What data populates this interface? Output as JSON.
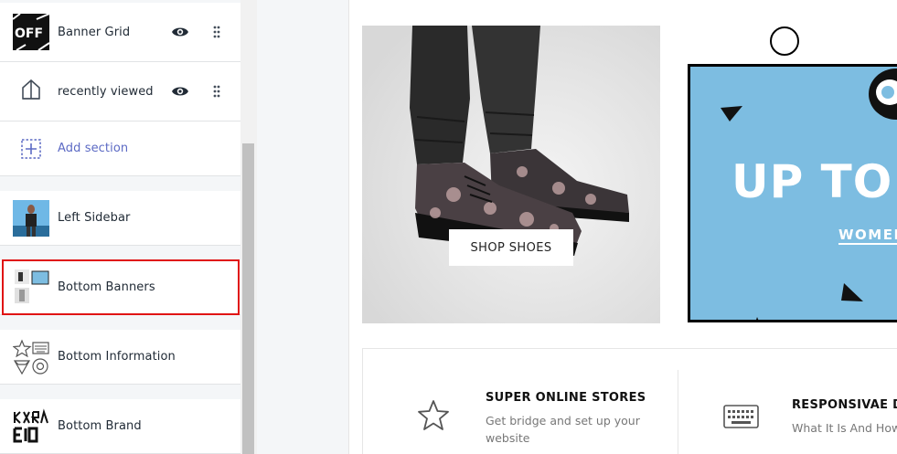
{
  "sidebar": {
    "sections_top": [
      {
        "label": "Banner Grid",
        "thumb": "off-sale-thumbnail",
        "visible_icon": "eye-icon"
      },
      {
        "label": "recently viewed",
        "thumb": "tag-icon",
        "visible_icon": "eye-icon"
      }
    ],
    "add_section_label": "Add section",
    "sections_bottom": [
      {
        "label": "Left Sidebar",
        "thumb": "model-thumbnail"
      },
      {
        "label": "Bottom Banners",
        "thumb": "banners-thumbnail"
      },
      {
        "label": "Bottom Information",
        "thumb": "info-icons-thumbnail"
      },
      {
        "label": "Bottom Brand",
        "thumb": "brand-thumbnail"
      }
    ],
    "off_thumb_text": "OFF"
  },
  "preview": {
    "banner1": {
      "button_label": "SHOP SHOES"
    },
    "banner2": {
      "headline": "UP TO",
      "link_label": "WOMEN"
    },
    "info": [
      {
        "title": "SUPER ONLINE STORES",
        "desc": "Get bridge and set up your website",
        "icon": "star-icon"
      },
      {
        "title": "RESPONSIVAE DE",
        "desc": "What It Is And How",
        "icon": "keyboard-icon"
      }
    ]
  },
  "colors": {
    "accent": "#5c6ac4",
    "highlight": "#e01414",
    "banner_blue": "#7dbde1"
  }
}
